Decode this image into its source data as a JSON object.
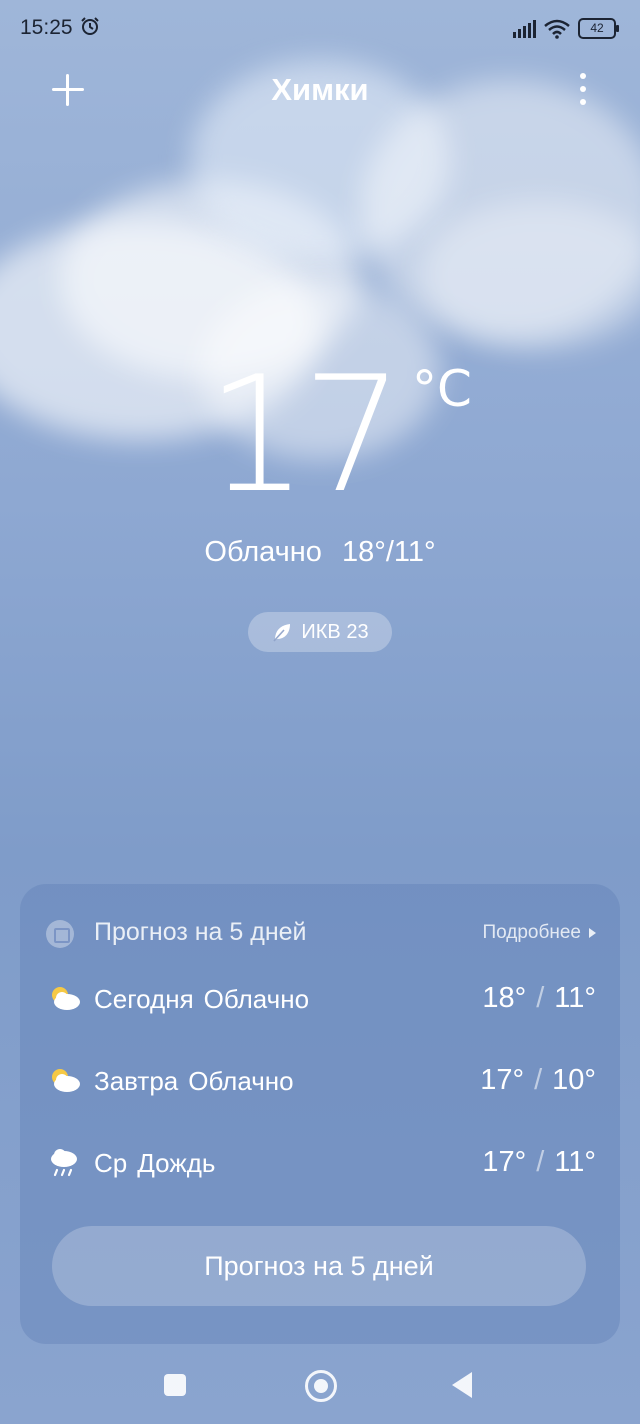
{
  "status_bar": {
    "time": "15:25",
    "battery": "42"
  },
  "header": {
    "city": "Химки"
  },
  "current": {
    "temperature": "17",
    "unit": "°C",
    "condition": "Облачно",
    "high_low": "18°/11°",
    "aqi_label": "ИКВ 23"
  },
  "forecast": {
    "title": "Прогноз на 5 дней",
    "more_label": "Подробнее",
    "days": [
      {
        "day": "Сегодня",
        "condition": "Облачно",
        "icon": "partly-cloudy-icon",
        "high": "18°",
        "low": "11°"
      },
      {
        "day": "Завтра",
        "condition": "Облачно",
        "icon": "partly-cloudy-icon",
        "high": "17°",
        "low": "10°"
      },
      {
        "day": "Ср",
        "condition": "Дождь",
        "icon": "rain-icon",
        "high": "17°",
        "low": "11°"
      }
    ],
    "separator": "/",
    "button_label": "Прогноз на 5 дней"
  }
}
